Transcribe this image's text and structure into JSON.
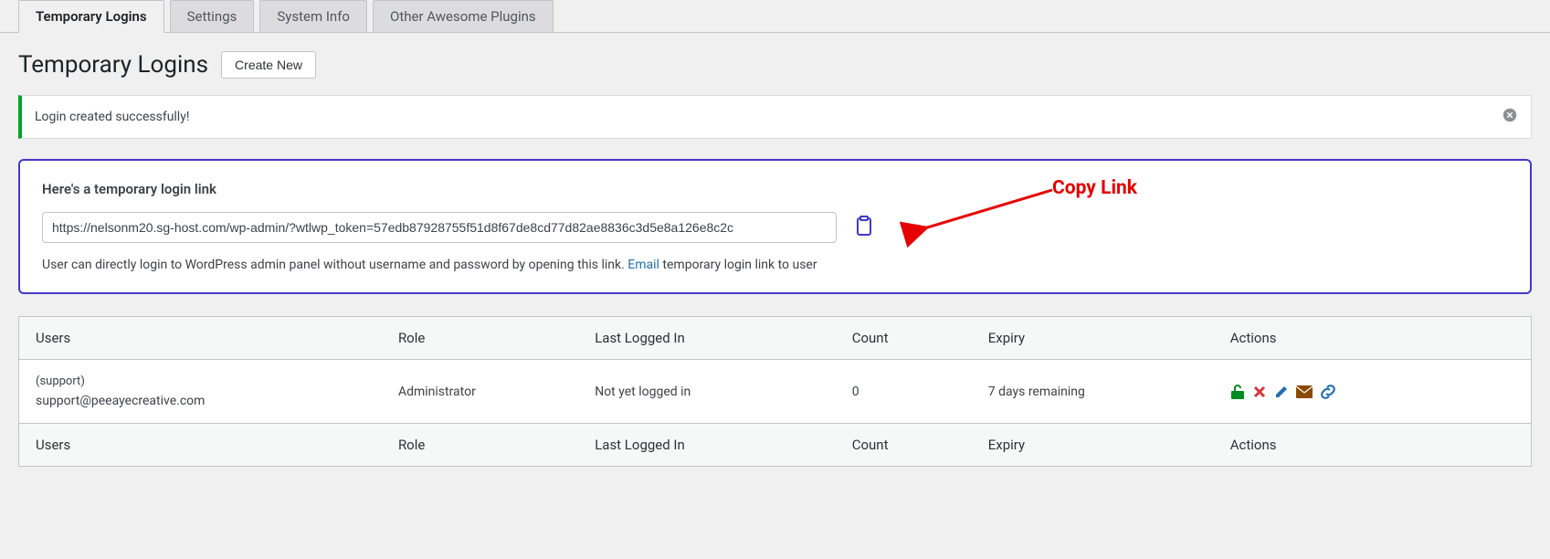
{
  "tabs": {
    "temporary_logins": "Temporary Logins",
    "settings": "Settings",
    "system_info": "System Info",
    "other_plugins": "Other Awesome Plugins"
  },
  "heading": "Temporary Logins",
  "create_button": "Create New",
  "notice": {
    "message": "Login created successfully!"
  },
  "link_box": {
    "title": "Here's a temporary login link",
    "url": "https://nelsonm20.sg-host.com/wp-admin/?wtlwp_token=57edb87928755f51d8f67de8cd77d82ae8836c3d5e8a126e8c2c",
    "desc_before": "User can directly login to WordPress admin panel without username and password by opening this link. ",
    "email_link": "Email",
    "desc_after": " temporary login link to user"
  },
  "annotation": {
    "label": "Copy Link"
  },
  "table": {
    "headers": {
      "users": "Users",
      "role": "Role",
      "last_logged_in": "Last Logged In",
      "count": "Count",
      "expiry": "Expiry",
      "actions": "Actions"
    },
    "rows": [
      {
        "user_name": "(support)",
        "user_email": "support@peeayecreative.com",
        "role": "Administrator",
        "last_logged_in": "Not yet logged in",
        "count": "0",
        "expiry": "7 days remaining"
      }
    ]
  }
}
